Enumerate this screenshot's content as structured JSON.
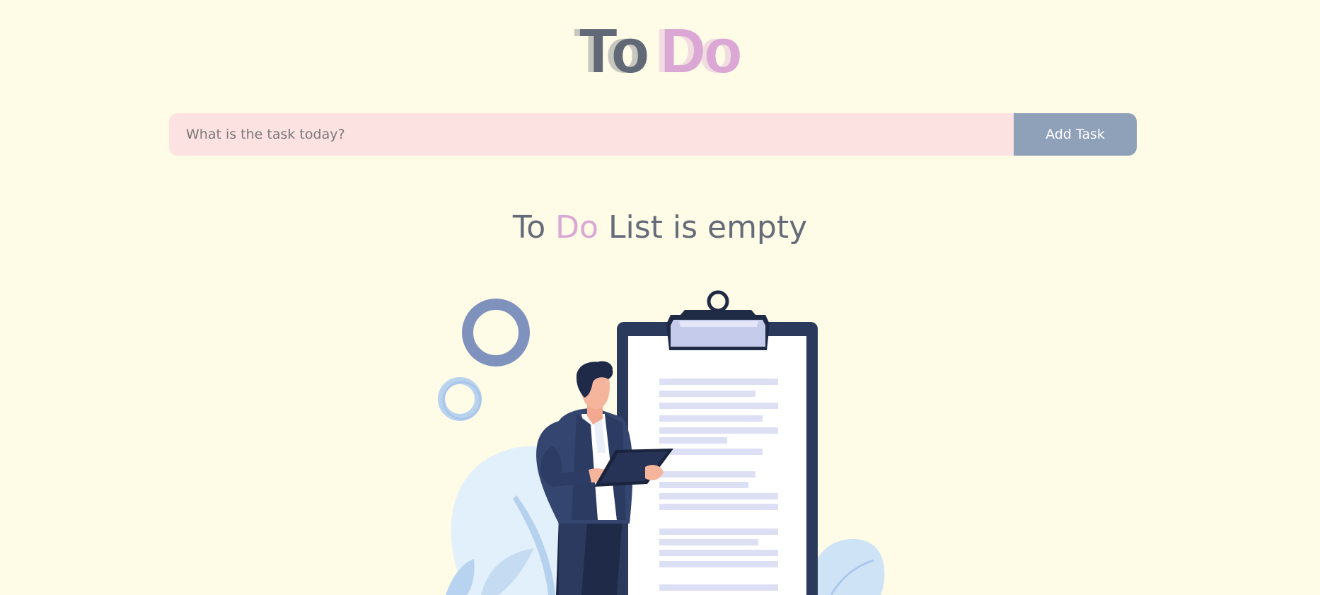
{
  "header": {
    "title_part1": "To",
    "title_part2": "Do"
  },
  "task_form": {
    "placeholder": "What is the task today?",
    "value": "",
    "add_button_label": "Add Task"
  },
  "empty_state": {
    "part1": "To",
    "part2": "Do",
    "part3": "List is empty",
    "illustration_icon": "empty-clipboard-illustration"
  },
  "colors": {
    "background": "#fefbe7",
    "title_dark": "#616876",
    "accent_pink": "#dba7d4",
    "input_background": "#fde2e2",
    "button_background": "#8fa0b9",
    "button_text": "#ffffff"
  }
}
